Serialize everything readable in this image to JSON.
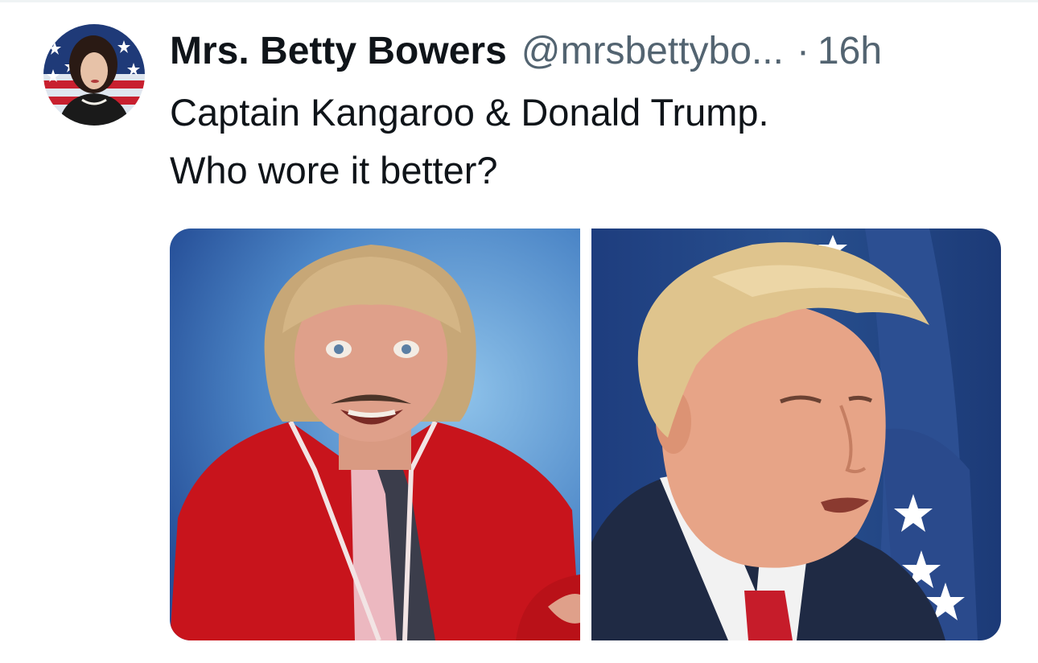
{
  "tweet": {
    "display_name": "Mrs. Betty Bowers",
    "handle": "@mrsbettybo...",
    "separator": "·",
    "timestamp": "16h",
    "text_lines": [
      "Captain Kangaroo & Donald Trump.",
      "Who wore it better?"
    ],
    "avatar_icon": "profile-avatar-icon",
    "media": [
      {
        "name": "photo-captain-kangaroo",
        "alt": "Captain Kangaroo in red jacket"
      },
      {
        "name": "photo-donald-trump",
        "alt": "Donald Trump in front of flag"
      }
    ]
  },
  "colors": {
    "primary_text": "#0f1419",
    "secondary_text": "#536471",
    "divider": "#eff3f4"
  }
}
